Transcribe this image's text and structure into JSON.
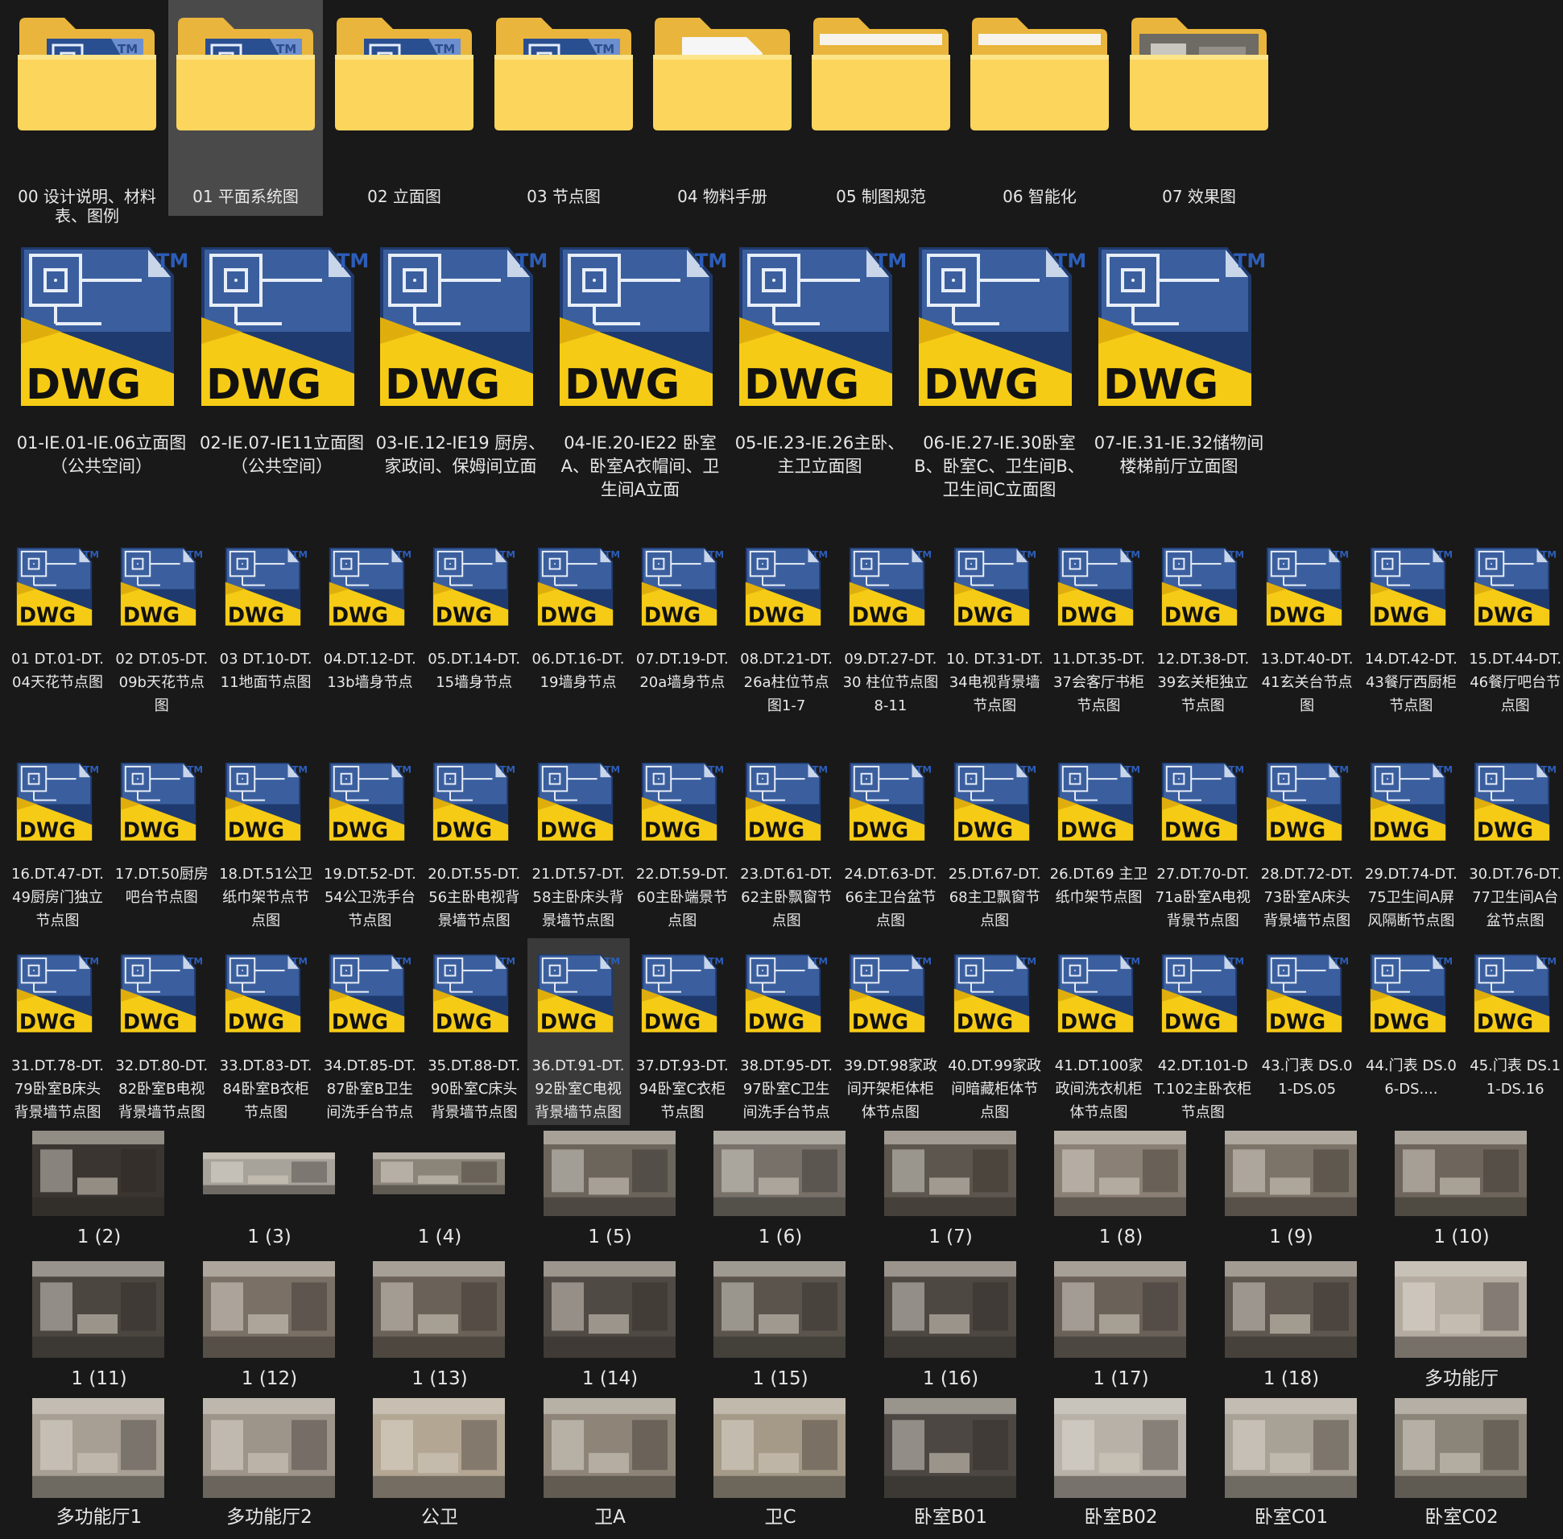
{
  "folders": [
    {
      "label": "00  设计说明、材料表、图例",
      "content": "dwg",
      "selected": false
    },
    {
      "label": "01 平面系统图",
      "content": "dwg",
      "selected": true
    },
    {
      "label": "02 立面图",
      "content": "dwg",
      "selected": false
    },
    {
      "label": "03 节点图",
      "content": "dwg",
      "selected": false
    },
    {
      "label": "04 物料手册",
      "content": "pdf",
      "selected": false
    },
    {
      "label": "05 制图规范",
      "content": "empty",
      "selected": false
    },
    {
      "label": "06 智能化",
      "content": "empty",
      "selected": false
    },
    {
      "label": "07 效果图",
      "content": "photo",
      "selected": false
    }
  ],
  "dwg_large": [
    "01-IE.01-IE.06立面图（公共空间）",
    "02-IE.07-IE11立面图（公共空间）",
    "03-IE.12-IE19 厨房、家政间、保姆间立面",
    "04-IE.20-IE22 卧室A、卧室A衣帽间、卫生间A立面",
    "05-IE.23-IE.26主卧、主卫立面图",
    "06-IE.27-IE.30卧室B、卧室C、卫生间B、卫生间C立面图",
    "07-IE.31-IE.32储物间 楼梯前厅立面图"
  ],
  "dwg_small": [
    [
      "01 DT.01-DT.04天花节点图",
      "02 DT.05-DT.09b天花节点图",
      "03 DT.10-DT.11地面节点图",
      "04.DT.12-DT.13b墙身节点",
      "05.DT.14-DT.15墙身节点",
      "06.DT.16-DT.19墙身节点",
      "07.DT.19-DT.20a墙身节点",
      "08.DT.21-DT.26a柱位节点图1-7",
      "09.DT.27-DT.30 柱位节点图8-11",
      "10. DT.31-DT.34电视背景墙节点图",
      "11.DT.35-DT.37会客厅书柜节点图",
      "12.DT.38-DT.39玄关柜独立节点图",
      "13.DT.40-DT.41玄关台节点图",
      "14.DT.42-DT.43餐厅西厨柜节点图",
      "15.DT.44-DT.46餐厅吧台节点图"
    ],
    [
      "16.DT.47-DT.49厨房门独立节点图",
      "17.DT.50厨房吧台节点图",
      "18.DT.51公卫纸巾架节点节点图",
      "19.DT.52-DT.54公卫洗手台节点图",
      "20.DT.55-DT.56主卧电视背景墙节点图",
      "21.DT.57-DT.58主卧床头背景墙节点图",
      "22.DT.59-DT.60主卧端景节点图",
      "23.DT.61-DT.62主卧飘窗节点图",
      "24.DT.63-DT.66主卫台盆节点图",
      "25.DT.67-DT.68主卫飘窗节点图",
      "26.DT.69 主卫纸巾架节点图",
      "27.DT.70-DT.71a卧室A电视背景节点图",
      "28.DT.72-DT.73卧室A床头背景墙节点图",
      "29.DT.74-DT.75卫生间A屏风隔断节点图",
      "30.DT.76-DT.77卫生间A台盆节点图"
    ],
    [
      "31.DT.78-DT.79卧室B床头背景墙节点图",
      "32.DT.80-DT.82卧室B电视背景墙节点图",
      "33.DT.83-DT.84卧室B衣柜节点图",
      "34.DT.85-DT.87卧室B卫生间洗手台节点",
      "35.DT.88-DT.90卧室C床头背景墙节点图",
      "36.DT.91-DT.92卧室C电视背景墙节点图",
      "37.DT.93-DT.94卧室C衣柜节点图",
      "38.DT.95-DT.97卧室C卫生间洗手台节点",
      "39.DT.98家政间开架柜体柜体节点图",
      "40.DT.99家政间暗藏柜体节点图",
      "41.DT.100家政间洗衣机柜体节点图",
      "42.DT.101-DT.102主卧衣柜节点图",
      "43.门表 DS.01-DS.05",
      "44.门表 DS.06-DS....",
      "45.门表 DS.11-DS.16"
    ]
  ],
  "dwg_small_hover_index": [
    2,
    5
  ],
  "thumbnails": [
    [
      {
        "label": "1 (2)",
        "tone": "#3a3530",
        "wide": false
      },
      {
        "label": "1 (3)",
        "tone": "#a8a39a",
        "wide": true
      },
      {
        "label": "1 (4)",
        "tone": "#8b8478",
        "wide": true
      },
      {
        "label": "1 (5)",
        "tone": "#6b655c",
        "wide": false
      },
      {
        "label": "1 (6)",
        "tone": "#77716a",
        "wide": false
      },
      {
        "label": "1 (7)",
        "tone": "#5c564e",
        "wide": false
      },
      {
        "label": "1 (8)",
        "tone": "#8a8075",
        "wide": false
      },
      {
        "label": "1 (9)",
        "tone": "#7c7468",
        "wide": false
      },
      {
        "label": "1 (10)",
        "tone": "#6e665c",
        "wide": false
      }
    ],
    [
      {
        "label": "1 (11)",
        "tone": "#4b4640",
        "wide": false
      },
      {
        "label": "1 (12)",
        "tone": "#7a7066",
        "wide": false
      },
      {
        "label": "1 (13)",
        "tone": "#6a6258",
        "wide": false
      },
      {
        "label": "1 (14)",
        "tone": "#504a44",
        "wide": false
      },
      {
        "label": "1 (15)",
        "tone": "#5a544d",
        "wide": false
      },
      {
        "label": "1 (16)",
        "tone": "#4e4842",
        "wide": false
      },
      {
        "label": "1 (17)",
        "tone": "#6a6259",
        "wide": false
      },
      {
        "label": "1 (18)",
        "tone": "#5e574f",
        "wide": false
      },
      {
        "label": "多功能厅",
        "tone": "#b4aba0",
        "wide": false
      }
    ],
    [
      {
        "label": "多功能厅1",
        "tone": "#a79f94",
        "wide": false
      },
      {
        "label": "多功能厅2",
        "tone": "#9e958a",
        "wide": false
      },
      {
        "label": "公卫",
        "tone": "#b3a794",
        "wide": false
      },
      {
        "label": "卫A",
        "tone": "#8e8578",
        "wide": false
      },
      {
        "label": "卫C",
        "tone": "#a59a88",
        "wide": false
      },
      {
        "label": "卧室B01",
        "tone": "#4c4742",
        "wide": false
      },
      {
        "label": "卧室B02",
        "tone": "#b7b1a8",
        "wide": false
      },
      {
        "label": "卧室C01",
        "tone": "#a8a196",
        "wide": false
      },
      {
        "label": "卧室C02",
        "tone": "#8a8479",
        "wide": false
      }
    ]
  ],
  "dwg_text": "DWG",
  "tm_text": "TM",
  "colors": {
    "background": "#191919",
    "folder_back": "#f0c04a",
    "folder_front": "#fbd968",
    "dwg_blue": "#2d4f8f",
    "dwg_yellow": "#f5cb16",
    "selected": "#4a4a4a"
  }
}
